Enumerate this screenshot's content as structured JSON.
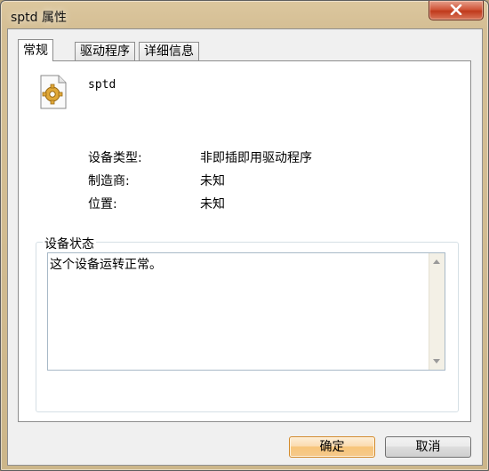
{
  "window": {
    "title": "sptd 属性"
  },
  "tabs": [
    {
      "label": "常规",
      "active": true
    },
    {
      "label": "驱动程序",
      "active": false
    },
    {
      "label": "详细信息",
      "active": false
    }
  ],
  "device": {
    "name": "sptd",
    "icon": "gear-document-icon",
    "properties": [
      {
        "label": "设备类型:",
        "value": "非即插即用驱动程序"
      },
      {
        "label": "制造商:",
        "value": "未知"
      },
      {
        "label": "位置:",
        "value": "未知"
      }
    ]
  },
  "status": {
    "legend": "设备状态",
    "text": "这个设备运转正常。"
  },
  "buttons": {
    "ok": "确定",
    "cancel": "取消"
  }
}
